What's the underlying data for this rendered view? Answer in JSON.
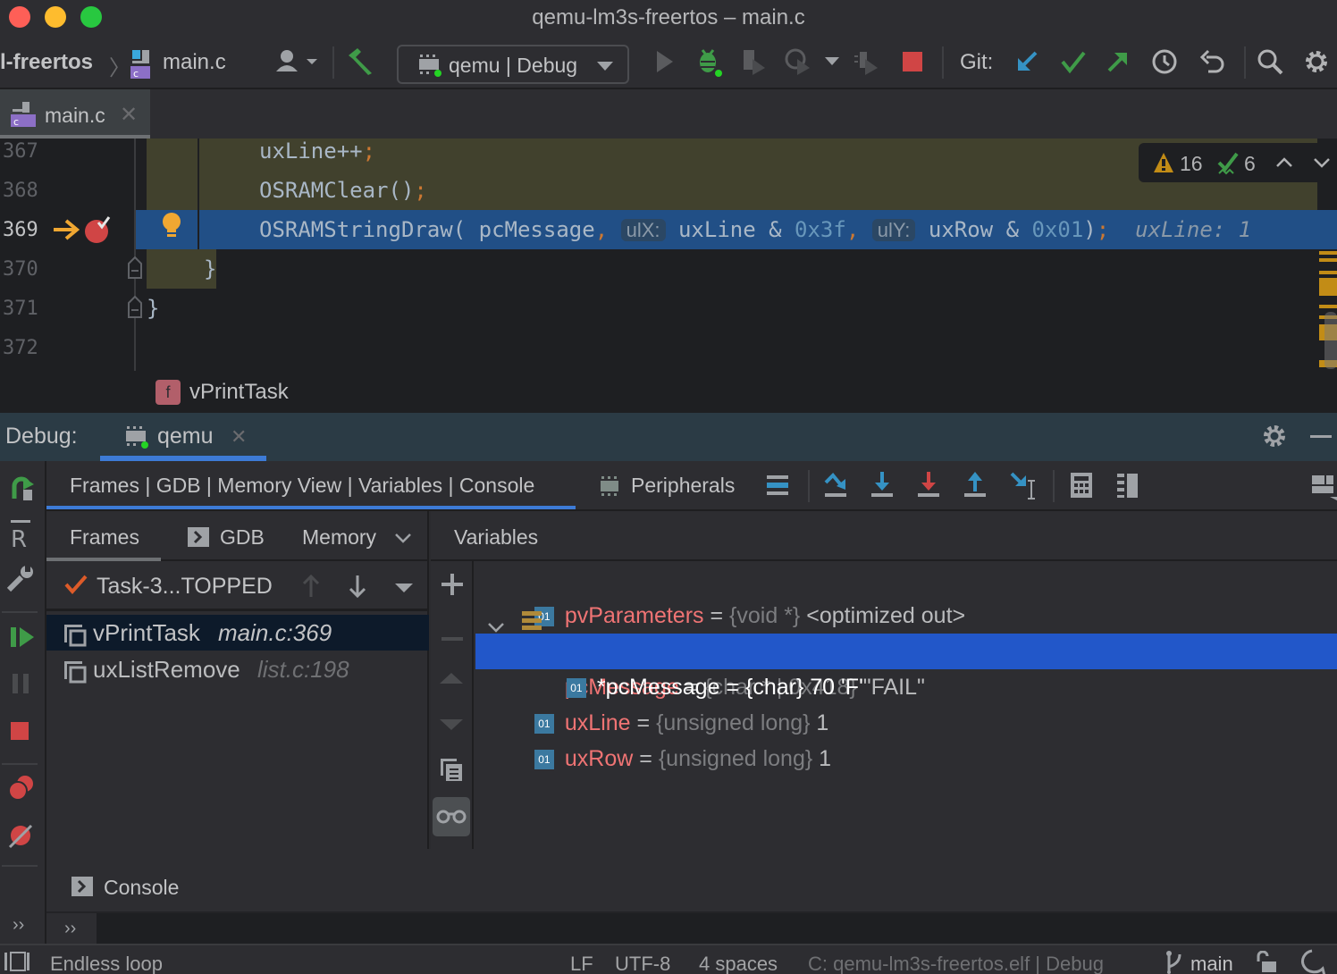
{
  "window": {
    "title": "qemu-lm3s-freertos – main.c"
  },
  "navbar": {
    "project": "l-freertos",
    "file": "main.c",
    "run_config": "qemu | Debug",
    "git_label": "Git:"
  },
  "editor_tab": {
    "label": "main.c"
  },
  "editor": {
    "lines": [
      {
        "num": "367",
        "code": "uxLine++",
        "end": ";"
      },
      {
        "num": "368",
        "code": "OSRAMClear()",
        "end": ";"
      },
      {
        "num": "369",
        "prefix": "OSRAMStringDraw( pcMessage",
        "comma": ",",
        "hint1": "ulX:",
        "arg1": " uxLine & ",
        "hex1": "0x3f",
        "comma2": ",",
        "hint2": "ulY:",
        "arg2": " uxRow & ",
        "hex2": "0x01",
        "close": ")",
        "end": ";",
        "inline_value": "uxLine: 1"
      },
      {
        "num": "370",
        "code": "}"
      },
      {
        "num": "371",
        "code": "}"
      },
      {
        "num": "372",
        "code": ""
      }
    ],
    "inspection": {
      "warnings": "16",
      "weak_warnings": "6"
    },
    "breadcrumb_function": "vPrintTask",
    "breadcrumb_badge": "f"
  },
  "debug": {
    "header_label": "Debug:",
    "session_tab": "qemu",
    "layout_tab": "Frames | GDB | Memory View | Variables | Console",
    "peripherals_label": "Peripherals",
    "subtabs": [
      "Frames",
      "GDB",
      "Memory"
    ],
    "variables_title": "Variables",
    "thread": "Task-3...TOPPED",
    "frames": [
      {
        "func": "vPrintTask",
        "loc": "main.c:369"
      },
      {
        "func": "uxListRemove",
        "loc": "list.c:198"
      }
    ],
    "variables": [
      {
        "name": "pvParameters",
        "eq": " = ",
        "type": "{void *}",
        "value": " <optimized out>",
        "badge": "01"
      },
      {
        "name": "pcMessage",
        "eq": " = ",
        "type": "{char * | 0x418}",
        "value": " \"FAIL\"",
        "badge": "array"
      },
      {
        "name": "*pcMessage",
        "eq": " = ",
        "type": "{char}",
        "value": " 70 'F'",
        "badge": "01"
      },
      {
        "name": "uxLine",
        "eq": " = ",
        "type": "{unsigned long}",
        "value": " 1",
        "badge": "01"
      },
      {
        "name": "uxRow",
        "eq": " = ",
        "type": "{unsigned long}",
        "value": " 1",
        "badge": "01"
      }
    ],
    "console_label": "Console",
    "prompt_symbol": "››"
  },
  "statusbar": {
    "message": "Endless loop",
    "line_sep": "LF",
    "encoding": "UTF-8",
    "indent": "4 spaces",
    "context": "C: qemu-lm3s-freertos.elf | Debug",
    "branch": "main"
  },
  "colors": {
    "accent": "#3d7bd6",
    "selected_var": "#2257c9",
    "exec_line": "#214f86",
    "modified_bg": "#41412d",
    "var_name": "#f07474",
    "stop": "#d04545",
    "run_green": "#3f9b48"
  }
}
